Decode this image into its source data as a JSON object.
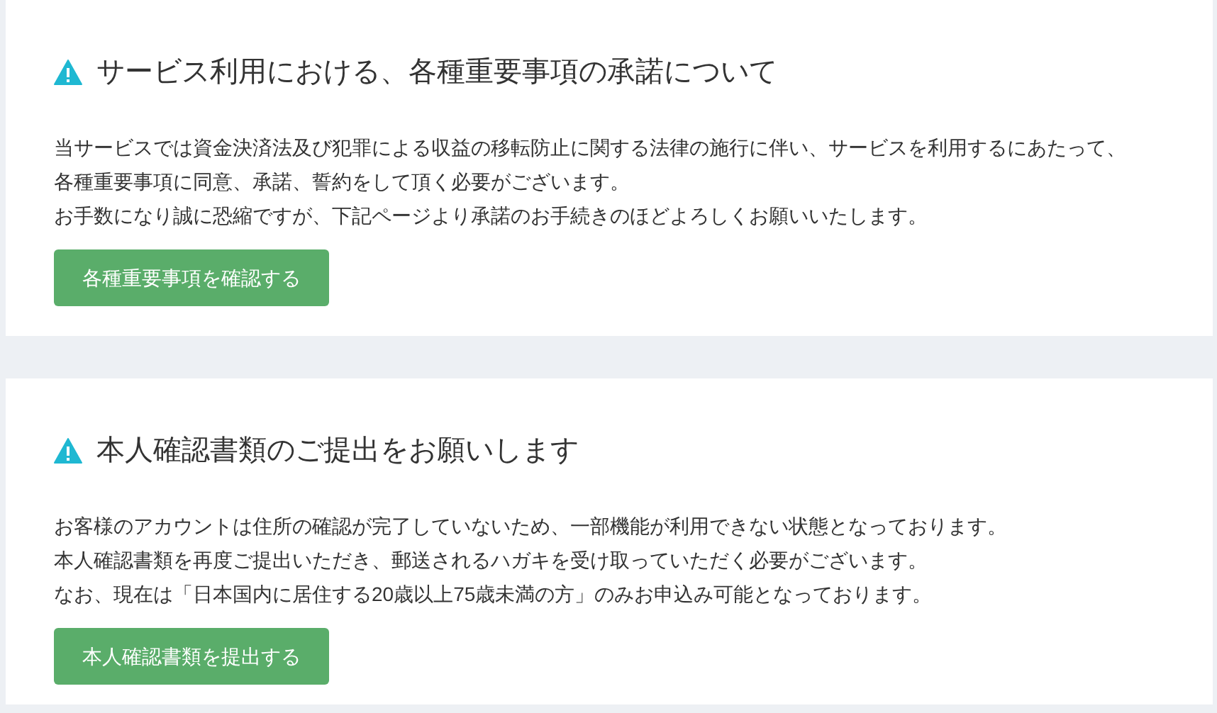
{
  "notices": [
    {
      "title": "サービス利用における、各種重要事項の承諾について",
      "lines": [
        "当サービスでは資金決済法及び犯罪による収益の移転防止に関する法律の施行に伴い、サービスを利用するにあたって、各種重要事項に同意、承諾、誓約をして頂く必要がございます。",
        "お手数になり誠に恐縮ですが、下記ページより承諾のお手続きのほどよろしくお願いいたします。"
      ],
      "button": "各種重要事項を確認する"
    },
    {
      "title": "本人確認書類のご提出をお願いします",
      "lines": [
        "お客様のアカウントは住所の確認が完了していないため、一部機能が利用できない状態となっております。",
        "本人確認書類を再度ご提出いただき、郵送されるハガキを受け取っていただく必要がございます。",
        "なお、現在は「日本国内に居住する20歳以上75歳未満の方」のみお申込み可能となっております。"
      ],
      "button": "本人確認書類を提出する"
    }
  ]
}
